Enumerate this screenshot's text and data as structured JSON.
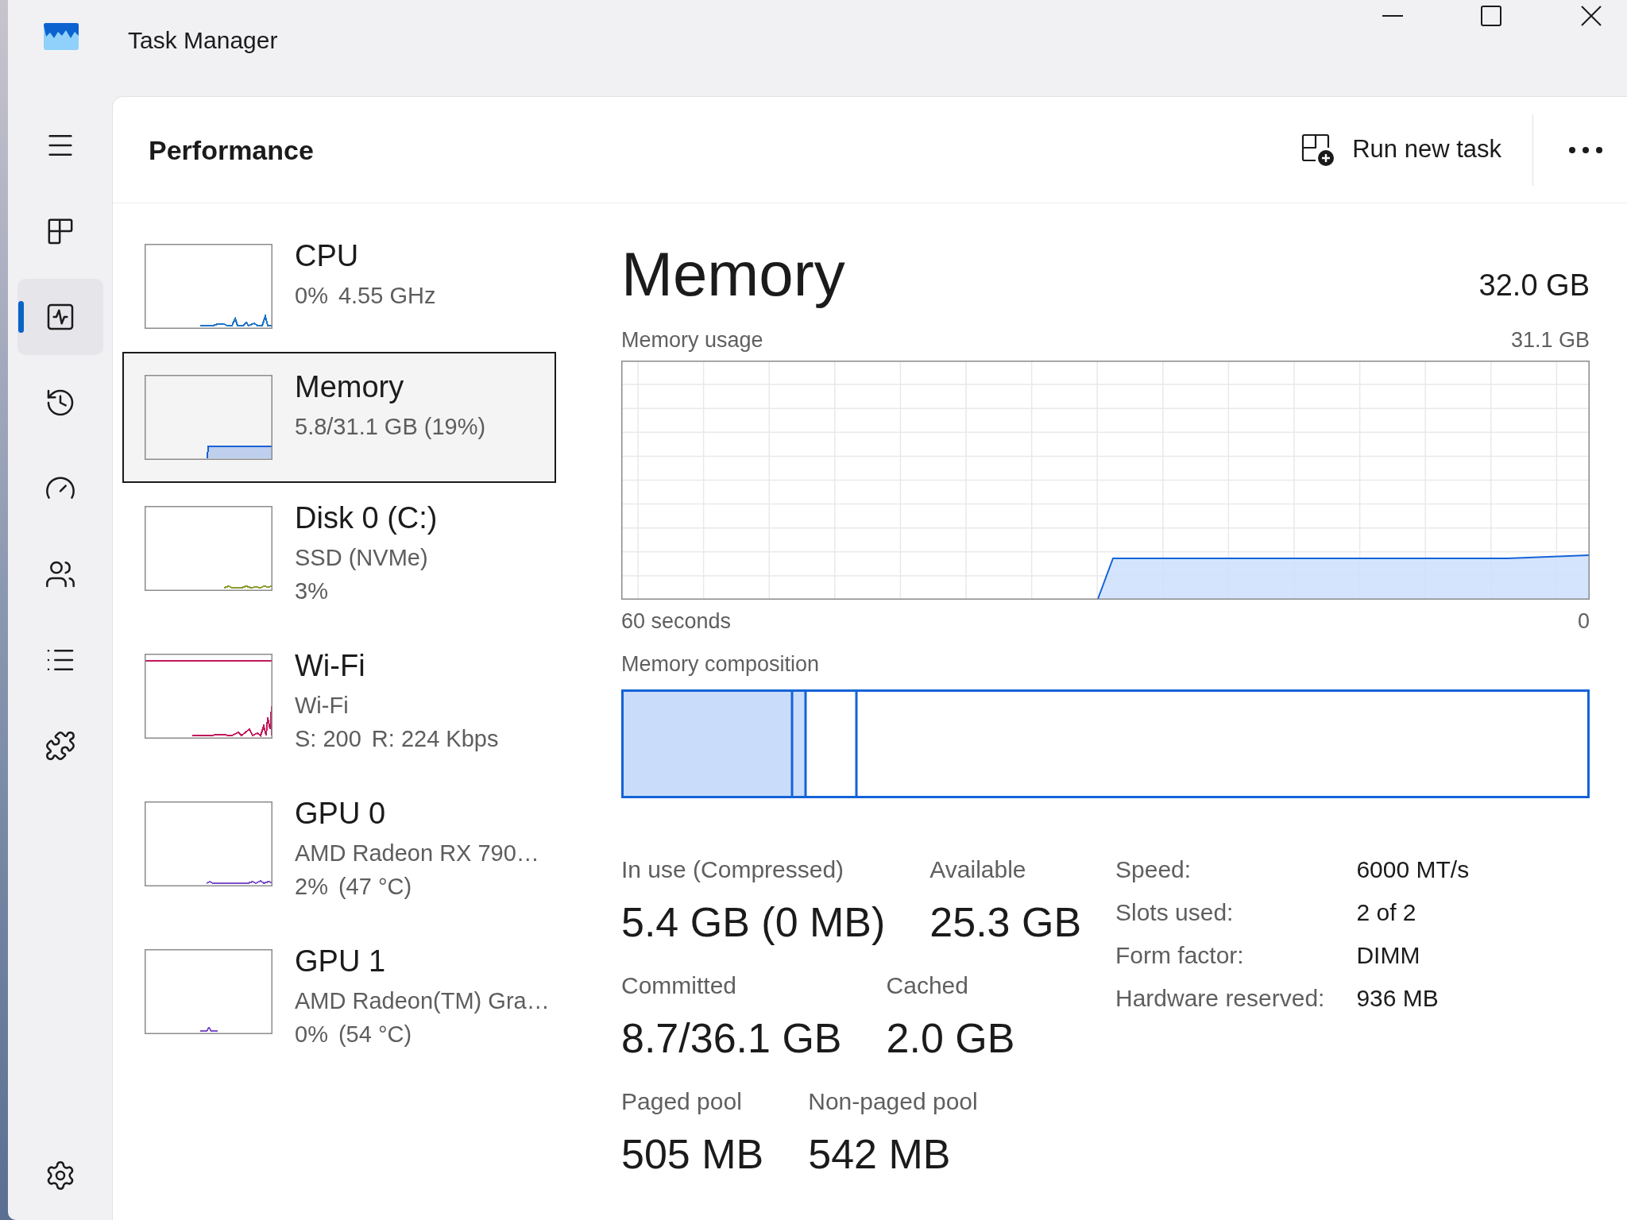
{
  "window": {
    "title": "Task Manager"
  },
  "nav": {
    "items": [
      {
        "selected": false
      },
      {
        "selected": true
      },
      {
        "selected": false
      },
      {
        "selected": false
      },
      {
        "selected": false
      },
      {
        "selected": false
      },
      {
        "selected": false
      }
    ]
  },
  "header": {
    "title": "Performance",
    "action": "Run new task"
  },
  "devices": [
    {
      "title": "CPU",
      "lines": [
        [
          "0%",
          "4.55 GHz"
        ]
      ],
      "selected": false,
      "color": "#1f74c8"
    },
    {
      "title": "Memory",
      "lines": [
        [
          "5.8/31.1 GB (19%)"
        ]
      ],
      "selected": true,
      "color": "#1a62d6"
    },
    {
      "title": "Disk 0 (C:)",
      "lines": [
        [
          "SSD (NVMe)"
        ],
        [
          "3%"
        ]
      ],
      "selected": false,
      "color": "#8c9a2e"
    },
    {
      "title": "Wi-Fi",
      "lines": [
        [
          "Wi-Fi"
        ],
        [
          "S: 200",
          "R: 224 Kbps"
        ]
      ],
      "selected": false,
      "color": "#c2185b"
    },
    {
      "title": "GPU 0",
      "lines": [
        [
          "AMD Radeon RX 790…"
        ],
        [
          "2%",
          "(47 °C)"
        ]
      ],
      "selected": false,
      "color": "#7b4fc9"
    },
    {
      "title": "GPU 1",
      "lines": [
        [
          "AMD Radeon(TM) Gra…"
        ],
        [
          "0%",
          "(54 °C)"
        ]
      ],
      "selected": false,
      "color": "#7b4fc9"
    }
  ],
  "detail": {
    "title": "Memory",
    "total": "32.0 GB",
    "usage_chart": {
      "label": "Memory usage",
      "max": "31.1 GB",
      "x_start": "60 seconds",
      "x_end": "0"
    },
    "composition_label": "Memory composition",
    "stats": [
      [
        {
          "label": "In use (Compressed)",
          "value": "5.4 GB (0 MB)"
        },
        {
          "label": "Available",
          "value": "25.3 GB"
        }
      ],
      [
        {
          "label": "Committed",
          "value": "8.7/36.1 GB"
        },
        {
          "label": "Cached",
          "value": "2.0 GB"
        }
      ],
      [
        {
          "label": "Paged pool",
          "value": "505 MB"
        },
        {
          "label": "Non-paged pool",
          "value": "542 MB"
        }
      ]
    ],
    "specs": [
      {
        "label": "Speed:",
        "value": "6000 MT/s"
      },
      {
        "label": "Slots used:",
        "value": "2 of 2"
      },
      {
        "label": "Form factor:",
        "value": "DIMM"
      },
      {
        "label": "Hardware reserved:",
        "value": "936 MB"
      }
    ]
  }
}
